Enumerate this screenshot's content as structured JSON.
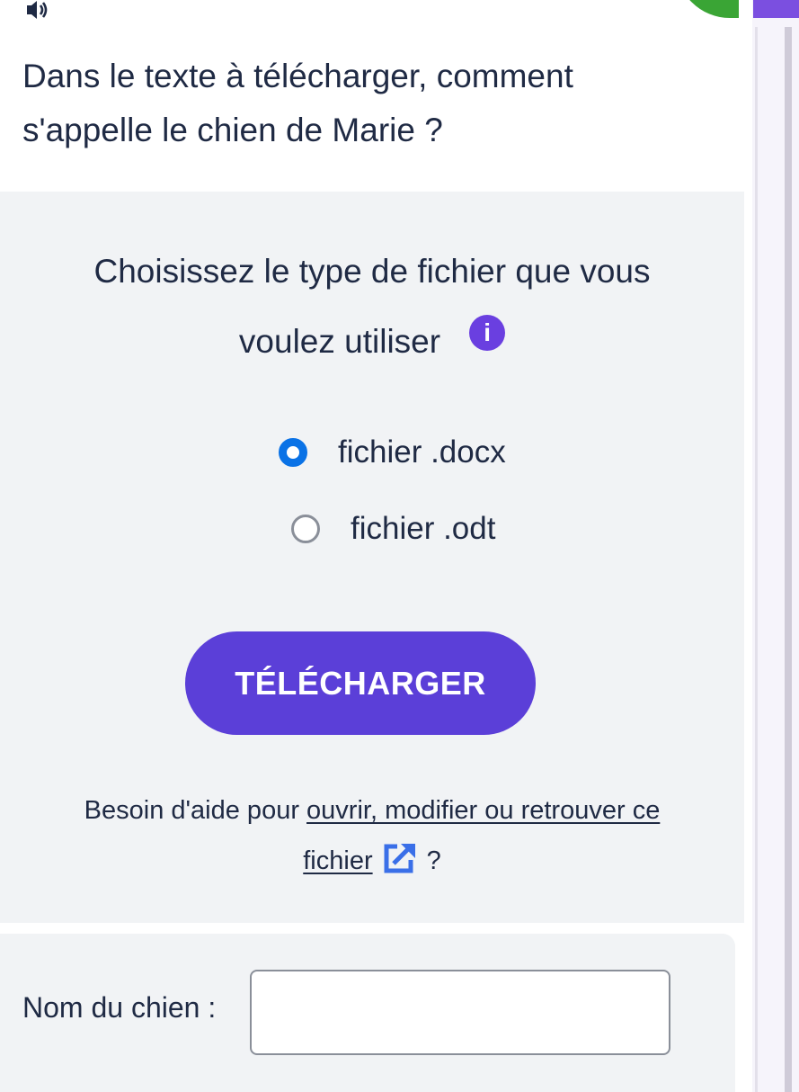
{
  "question": {
    "line1": "Dans le texte à télécharger, comment",
    "line2": "s'appelle le chien de Marie ?"
  },
  "file_choice": {
    "title_line1": "Choisissez le type de fichier que vous",
    "title_line2": "voulez utiliser",
    "info_glyph": "i",
    "options": [
      {
        "label": "fichier .docx",
        "selected": true
      },
      {
        "label": "fichier .odt",
        "selected": false
      }
    ]
  },
  "download_button": {
    "label": "TÉLÉCHARGER"
  },
  "help": {
    "prefix": "Besoin d'aide pour",
    "link_part1": "ouvrir, modifier ou retrouver ce",
    "link_part2": "fichier",
    "suffix": "?"
  },
  "answer": {
    "label": "Nom du chien :",
    "value": ""
  },
  "icons": [
    "speaker-icon",
    "info-icon",
    "external-link-icon"
  ],
  "colors": {
    "accent": "#5b3fd8",
    "radio_selected": "#0a72e6",
    "panel_bg": "#f1f3f5",
    "text": "#1f2a44"
  }
}
